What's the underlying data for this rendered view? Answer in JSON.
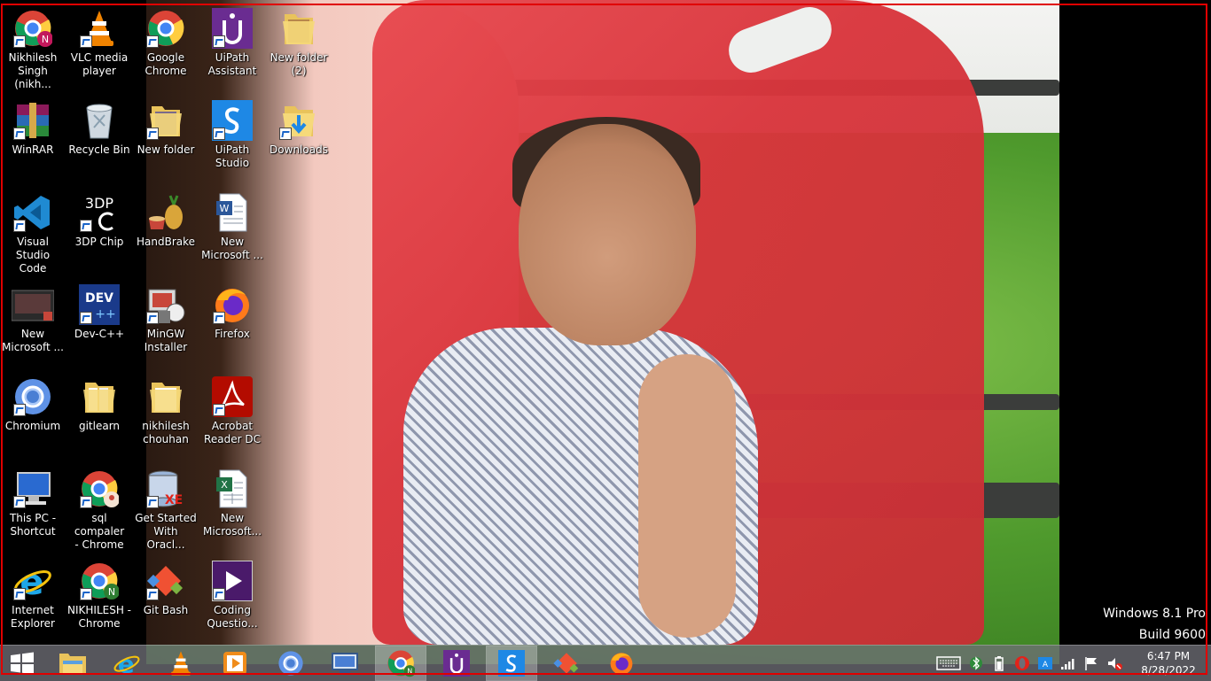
{
  "desktop_icons": [
    {
      "label": "Nikhilesh\nSingh (nikh...",
      "icon": "chrome-profile-icon"
    },
    {
      "label": "VLC media\nplayer",
      "icon": "vlc-icon"
    },
    {
      "label": "Google\nChrome",
      "icon": "chrome-icon"
    },
    {
      "label": "UiPath\nAssistant",
      "icon": "uipath-assistant-icon"
    },
    {
      "label": "New folder\n(2)",
      "icon": "folder-icon"
    },
    {
      "label": "WinRAR",
      "icon": "winrar-icon"
    },
    {
      "label": "Recycle Bin",
      "icon": "recycle-bin-icon"
    },
    {
      "label": "New folder",
      "icon": "folder-icon"
    },
    {
      "label": "UiPath\nStudio",
      "icon": "uipath-studio-icon"
    },
    {
      "label": "Downloads",
      "icon": "downloads-folder-icon"
    },
    {
      "label": "Visual Studio\nCode",
      "icon": "vscode-icon"
    },
    {
      "label": "3DP Chip",
      "icon": "3dp-chip-icon"
    },
    {
      "label": "HandBrake",
      "icon": "handbrake-icon"
    },
    {
      "label": "New\nMicrosoft ...",
      "icon": "word-document-icon"
    },
    {
      "label": "New\nMicrosoft ...",
      "icon": "access-database-icon"
    },
    {
      "label": "Dev-C++",
      "icon": "devcpp-icon"
    },
    {
      "label": "MinGW\nInstaller",
      "icon": "mingw-icon"
    },
    {
      "label": "Firefox",
      "icon": "firefox-icon"
    },
    {
      "label": "Chromium",
      "icon": "chromium-icon"
    },
    {
      "label": "gitlearn",
      "icon": "folder-icon"
    },
    {
      "label": "nikhilesh\nchouhan",
      "icon": "folder-icon"
    },
    {
      "label": "Acrobat\nReader DC",
      "icon": "acrobat-icon"
    },
    {
      "label": "This PC -\nShortcut",
      "icon": "this-pc-icon"
    },
    {
      "label": "sql compaler\n- Chrome",
      "icon": "chrome-app-icon"
    },
    {
      "label": "Get Started\nWith Oracl...",
      "icon": "oracle-xe-icon"
    },
    {
      "label": "New\nMicrosoft...",
      "icon": "excel-document-icon"
    },
    {
      "label": "Internet\nExplorer",
      "icon": "ie-icon"
    },
    {
      "label": "NIKHILESH -\nChrome",
      "icon": "chrome-profile-icon"
    },
    {
      "label": "Git Bash",
      "icon": "git-bash-icon"
    },
    {
      "label": "Coding\nQuestio...",
      "icon": "media-player-icon"
    }
  ],
  "watermark": {
    "line1": "Windows 8.1 Pro",
    "line2": "Build 9600"
  },
  "taskbar": {
    "items": [
      {
        "name": "start-button",
        "icon": "windows-logo-icon"
      },
      {
        "name": "file-explorer",
        "icon": "file-explorer-icon"
      },
      {
        "name": "internet-explorer",
        "icon": "ie-icon"
      },
      {
        "name": "vlc",
        "icon": "vlc-icon"
      },
      {
        "name": "media-player",
        "icon": "media-player-icon"
      },
      {
        "name": "chromium",
        "icon": "chromium-icon"
      },
      {
        "name": "remote-desktop",
        "icon": "remote-desktop-icon"
      },
      {
        "name": "chrome-nikhilesh",
        "icon": "chrome-profile-icon",
        "active": true
      },
      {
        "name": "uipath-assistant",
        "icon": "uipath-assistant-icon"
      },
      {
        "name": "uipath-studio",
        "icon": "uipath-studio-icon",
        "active": true
      },
      {
        "name": "git",
        "icon": "git-icon"
      },
      {
        "name": "firefox",
        "icon": "firefox-icon"
      }
    ],
    "tray_icons": [
      "keyboard-icon",
      "bluetooth-icon",
      "battery-icon",
      "opera-icon",
      "language-icon",
      "network-signal-icon",
      "action-center-flag-icon",
      "volume-muted-icon"
    ],
    "clock_time": "6:47 PM",
    "clock_date": "8/28/2022"
  },
  "colors": {
    "frame": "#e00000",
    "taskbar": "#6e6e76",
    "label_text": "#ffffff"
  }
}
